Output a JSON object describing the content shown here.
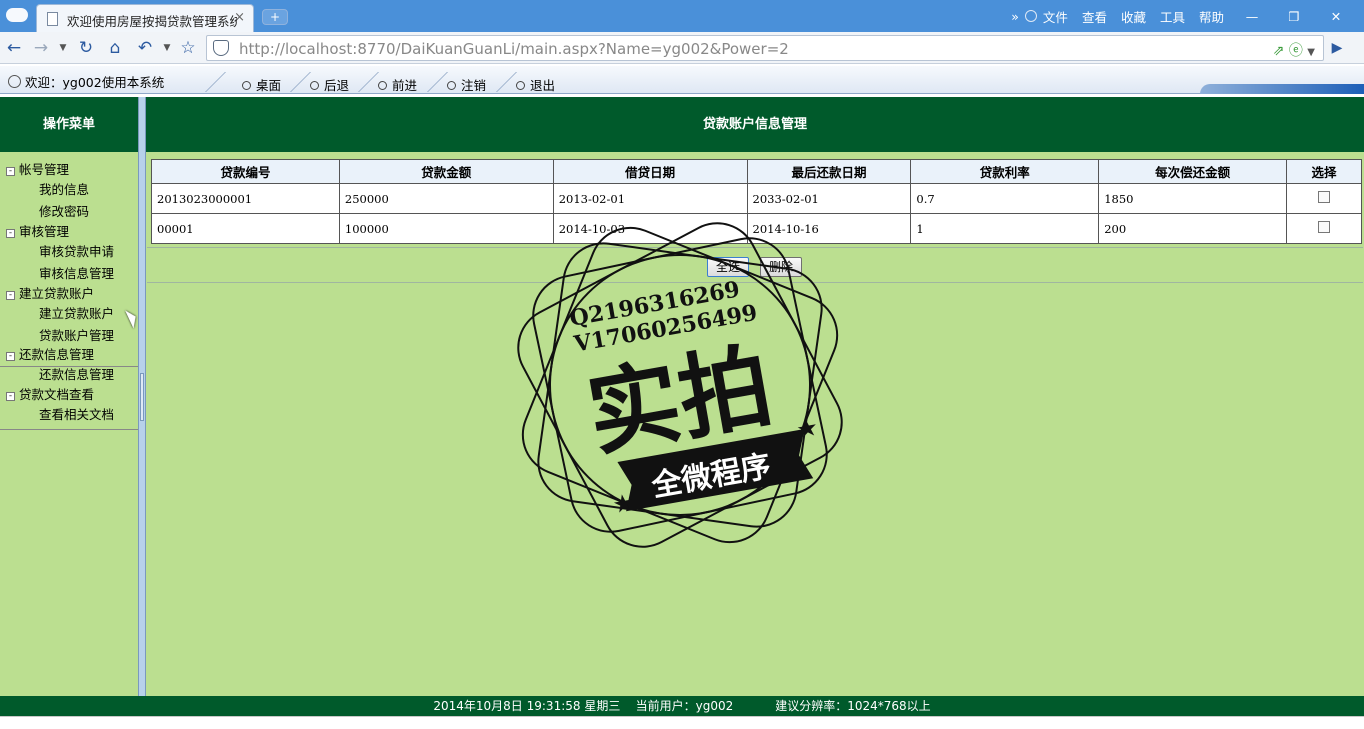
{
  "browser": {
    "tab_title": "欢迎使用房屋按揭贷款管理系统",
    "tab_close": "×",
    "new_tab": "+",
    "url_host": "http://localhost",
    "url_path": ":8770/DaiKuanGuanLi/main.aspx?Name=yg002&Power=2",
    "menu": [
      "文件",
      "查看",
      "收藏",
      "工具",
      "帮助"
    ],
    "more": "»",
    "window_buttons": [
      "—",
      "❐",
      "✕"
    ]
  },
  "app_top": {
    "welcome": "欢迎：yg002使用本系统",
    "links": [
      "桌面",
      "后退",
      "前进",
      "注销",
      "退出"
    ]
  },
  "sidebar": {
    "title": "操作菜单",
    "groups": [
      {
        "label": "帐号管理",
        "items": [
          "我的信息",
          "修改密码"
        ]
      },
      {
        "label": "审核管理",
        "items": [
          "审核贷款申请",
          "审核信息管理"
        ]
      },
      {
        "label": "建立贷款账户",
        "items": [
          "建立贷款账户",
          "贷款账户管理"
        ]
      },
      {
        "label": "还款信息管理",
        "items": [
          "还款信息管理"
        ]
      },
      {
        "label": "贷款文档查看",
        "items": [
          "查看相关文档"
        ]
      }
    ]
  },
  "main": {
    "title": "贷款账户信息管理",
    "columns": [
      "贷款编号",
      "贷款金额",
      "借贷日期",
      "最后还款日期",
      "贷款利率",
      "每次偿还金额",
      "选择"
    ],
    "rows": [
      [
        "2013023000001",
        "250000",
        "2013-02-01",
        "2033-02-01",
        "0.7",
        "1850"
      ],
      [
        "00001",
        "100000",
        "2014-10-03",
        "2014-10-16",
        "1",
        "200"
      ]
    ],
    "select_all_label": "全选",
    "delete_label": "删除"
  },
  "watermark": {
    "line1": "Q2196316269",
    "line2": "V17060256499",
    "big": "实拍",
    "banner": "全微程序"
  },
  "footer": {
    "datetime": "2014年10月8日 19:31:58 星期三",
    "user": "当前用户：yg002",
    "resolution": "建议分辨率：1024*768以上"
  }
}
